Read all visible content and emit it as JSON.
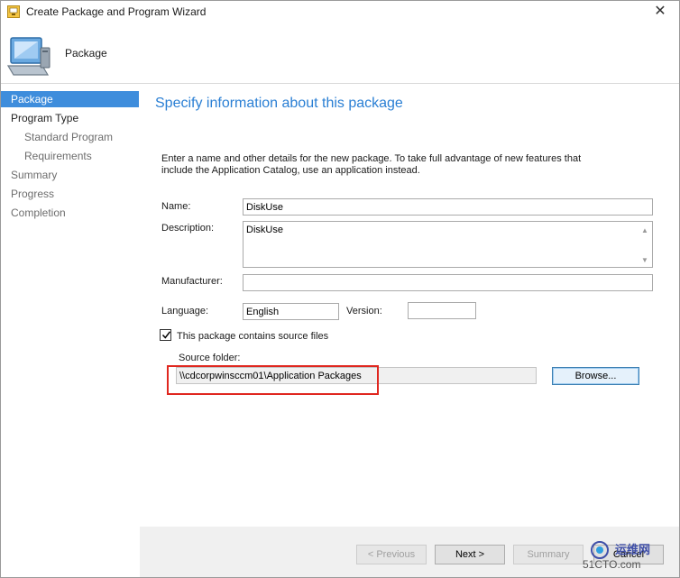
{
  "window": {
    "title": "Create Package and Program Wizard",
    "close_glyph": "✕"
  },
  "header": {
    "title": "Package"
  },
  "nav": {
    "items": [
      {
        "label": "Package"
      },
      {
        "label": "Program Type"
      },
      {
        "label": "Standard Program"
      },
      {
        "label": "Requirements"
      },
      {
        "label": "Summary"
      },
      {
        "label": "Progress"
      },
      {
        "label": "Completion"
      }
    ]
  },
  "main": {
    "heading": "Specify information about this package",
    "intro": "Enter a name and other details for the new package. To take full advantage of new features that include the Application Catalog, use an application instead.",
    "name_label": "Name:",
    "name_value": "DiskUse",
    "description_label": "Description:",
    "description_value": "DiskUse",
    "manufacturer_label": "Manufacturer:",
    "manufacturer_value": "",
    "language_label": "Language:",
    "language_value": "English",
    "version_label": "Version:",
    "version_value": "",
    "source_checkbox_label": "This package contains source files",
    "source_checkbox_checked": true,
    "source_folder_label": "Source folder:",
    "source_folder_value": "\\\\cdcorpwinsccm01\\Application Packages",
    "browse_label": "Browse..."
  },
  "footer": {
    "previous_label": "< Previous",
    "next_label": "Next >",
    "summary_label": "Summary",
    "cancel_label": "Cancel"
  },
  "watermark": {
    "line1": "运维网",
    "line2": "51CTO.com"
  },
  "colors": {
    "accent": "#3e8ddc",
    "heading": "#2a7fd4",
    "highlight": "#e0271f"
  }
}
